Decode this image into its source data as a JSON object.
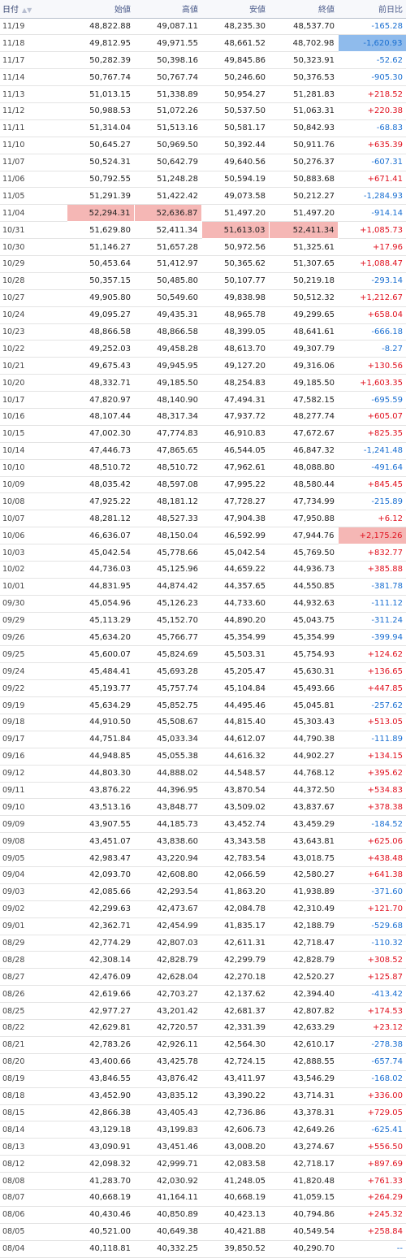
{
  "headers": [
    "日付",
    "始値",
    "高値",
    "安値",
    "終値",
    "前日比"
  ],
  "sort_icon": "▲▼",
  "colors": {
    "up": "#e0101e",
    "down": "#1a6fd1",
    "high_highlight": "#f5b7b5",
    "low_highlight": "#8fbbec"
  },
  "rows": [
    [
      "11/19",
      "48,822.88",
      "49,087.11",
      "48,235.30",
      "48,537.70",
      "-165.28"
    ],
    [
      "11/18",
      "49,812.95",
      "49,971.55",
      "48,661.52",
      "48,702.98",
      "-1,620.93"
    ],
    [
      "11/17",
      "50,282.39",
      "50,398.16",
      "49,845.86",
      "50,323.91",
      "-52.62"
    ],
    [
      "11/14",
      "50,767.74",
      "50,767.74",
      "50,246.60",
      "50,376.53",
      "-905.30"
    ],
    [
      "11/13",
      "51,013.15",
      "51,338.89",
      "50,954.27",
      "51,281.83",
      "+218.52"
    ],
    [
      "11/12",
      "50,988.53",
      "51,072.26",
      "50,537.50",
      "51,063.31",
      "+220.38"
    ],
    [
      "11/11",
      "51,314.04",
      "51,513.16",
      "50,581.17",
      "50,842.93",
      "-68.83"
    ],
    [
      "11/10",
      "50,645.27",
      "50,969.50",
      "50,392.44",
      "50,911.76",
      "+635.39"
    ],
    [
      "11/07",
      "50,524.31",
      "50,642.79",
      "49,640.56",
      "50,276.37",
      "-607.31"
    ],
    [
      "11/06",
      "50,792.55",
      "51,248.28",
      "50,594.19",
      "50,883.68",
      "+671.41"
    ],
    [
      "11/05",
      "51,291.39",
      "51,422.42",
      "49,073.58",
      "50,212.27",
      "-1,284.93"
    ],
    [
      "11/04",
      "52,294.31",
      "52,636.87",
      "51,497.20",
      "51,497.20",
      "-914.14"
    ],
    [
      "10/31",
      "51,629.80",
      "52,411.34",
      "51,613.03",
      "52,411.34",
      "+1,085.73"
    ],
    [
      "10/30",
      "51,146.27",
      "51,657.28",
      "50,972.56",
      "51,325.61",
      "+17.96"
    ],
    [
      "10/29",
      "50,453.64",
      "51,412.97",
      "50,365.62",
      "51,307.65",
      "+1,088.47"
    ],
    [
      "10/28",
      "50,357.15",
      "50,485.80",
      "50,107.77",
      "50,219.18",
      "-293.14"
    ],
    [
      "10/27",
      "49,905.80",
      "50,549.60",
      "49,838.98",
      "50,512.32",
      "+1,212.67"
    ],
    [
      "10/24",
      "49,095.27",
      "49,435.31",
      "48,965.78",
      "49,299.65",
      "+658.04"
    ],
    [
      "10/23",
      "48,866.58",
      "48,866.58",
      "48,399.05",
      "48,641.61",
      "-666.18"
    ],
    [
      "10/22",
      "49,252.03",
      "49,458.28",
      "48,613.70",
      "49,307.79",
      "-8.27"
    ],
    [
      "10/21",
      "49,675.43",
      "49,945.95",
      "49,127.20",
      "49,316.06",
      "+130.56"
    ],
    [
      "10/20",
      "48,332.71",
      "49,185.50",
      "48,254.83",
      "49,185.50",
      "+1,603.35"
    ],
    [
      "10/17",
      "47,820.97",
      "48,140.90",
      "47,494.31",
      "47,582.15",
      "-695.59"
    ],
    [
      "10/16",
      "48,107.44",
      "48,317.34",
      "47,937.72",
      "48,277.74",
      "+605.07"
    ],
    [
      "10/15",
      "47,002.30",
      "47,774.83",
      "46,910.83",
      "47,672.67",
      "+825.35"
    ],
    [
      "10/14",
      "47,446.73",
      "47,865.65",
      "46,544.05",
      "46,847.32",
      "-1,241.48"
    ],
    [
      "10/10",
      "48,510.72",
      "48,510.72",
      "47,962.61",
      "48,088.80",
      "-491.64"
    ],
    [
      "10/09",
      "48,035.42",
      "48,597.08",
      "47,995.22",
      "48,580.44",
      "+845.45"
    ],
    [
      "10/08",
      "47,925.22",
      "48,181.12",
      "47,728.27",
      "47,734.99",
      "-215.89"
    ],
    [
      "10/07",
      "48,281.12",
      "48,527.33",
      "47,904.38",
      "47,950.88",
      "+6.12"
    ],
    [
      "10/06",
      "46,636.07",
      "48,150.04",
      "46,592.99",
      "47,944.76",
      "+2,175.26"
    ],
    [
      "10/03",
      "45,042.54",
      "45,778.66",
      "45,042.54",
      "45,769.50",
      "+832.77"
    ],
    [
      "10/02",
      "44,736.03",
      "45,125.96",
      "44,659.22",
      "44,936.73",
      "+385.88"
    ],
    [
      "10/01",
      "44,831.95",
      "44,874.42",
      "44,357.65",
      "44,550.85",
      "-381.78"
    ],
    [
      "09/30",
      "45,054.96",
      "45,126.23",
      "44,733.60",
      "44,932.63",
      "-111.12"
    ],
    [
      "09/29",
      "45,113.29",
      "45,152.70",
      "44,890.20",
      "45,043.75",
      "-311.24"
    ],
    [
      "09/26",
      "45,634.20",
      "45,766.77",
      "45,354.99",
      "45,354.99",
      "-399.94"
    ],
    [
      "09/25",
      "45,600.07",
      "45,824.69",
      "45,503.31",
      "45,754.93",
      "+124.62"
    ],
    [
      "09/24",
      "45,484.41",
      "45,693.28",
      "45,205.47",
      "45,630.31",
      "+136.65"
    ],
    [
      "09/22",
      "45,193.77",
      "45,757.74",
      "45,104.84",
      "45,493.66",
      "+447.85"
    ],
    [
      "09/19",
      "45,634.29",
      "45,852.75",
      "44,495.46",
      "45,045.81",
      "-257.62"
    ],
    [
      "09/18",
      "44,910.50",
      "45,508.67",
      "44,815.40",
      "45,303.43",
      "+513.05"
    ],
    [
      "09/17",
      "44,751.84",
      "45,033.34",
      "44,612.07",
      "44,790.38",
      "-111.89"
    ],
    [
      "09/16",
      "44,948.85",
      "45,055.38",
      "44,616.32",
      "44,902.27",
      "+134.15"
    ],
    [
      "09/12",
      "44,803.30",
      "44,888.02",
      "44,548.57",
      "44,768.12",
      "+395.62"
    ],
    [
      "09/11",
      "43,876.22",
      "44,396.95",
      "43,870.54",
      "44,372.50",
      "+534.83"
    ],
    [
      "09/10",
      "43,513.16",
      "43,848.77",
      "43,509.02",
      "43,837.67",
      "+378.38"
    ],
    [
      "09/09",
      "43,907.55",
      "44,185.73",
      "43,452.74",
      "43,459.29",
      "-184.52"
    ],
    [
      "09/08",
      "43,451.07",
      "43,838.60",
      "43,343.58",
      "43,643.81",
      "+625.06"
    ],
    [
      "09/05",
      "42,983.47",
      "43,220.94",
      "42,783.54",
      "43,018.75",
      "+438.48"
    ],
    [
      "09/04",
      "42,093.70",
      "42,608.80",
      "42,066.59",
      "42,580.27",
      "+641.38"
    ],
    [
      "09/03",
      "42,085.66",
      "42,293.54",
      "41,863.20",
      "41,938.89",
      "-371.60"
    ],
    [
      "09/02",
      "42,299.63",
      "42,473.67",
      "42,084.78",
      "42,310.49",
      "+121.70"
    ],
    [
      "09/01",
      "42,362.71",
      "42,454.99",
      "41,835.17",
      "42,188.79",
      "-529.68"
    ],
    [
      "08/29",
      "42,774.29",
      "42,807.03",
      "42,611.31",
      "42,718.47",
      "-110.32"
    ],
    [
      "08/28",
      "42,308.14",
      "42,828.79",
      "42,299.79",
      "42,828.79",
      "+308.52"
    ],
    [
      "08/27",
      "42,476.09",
      "42,628.04",
      "42,270.18",
      "42,520.27",
      "+125.87"
    ],
    [
      "08/26",
      "42,619.66",
      "42,703.27",
      "42,137.62",
      "42,394.40",
      "-413.42"
    ],
    [
      "08/25",
      "42,977.27",
      "43,201.42",
      "42,681.37",
      "42,807.82",
      "+174.53"
    ],
    [
      "08/22",
      "42,629.81",
      "42,720.57",
      "42,331.39",
      "42,633.29",
      "+23.12"
    ],
    [
      "08/21",
      "42,783.26",
      "42,926.11",
      "42,564.30",
      "42,610.17",
      "-278.38"
    ],
    [
      "08/20",
      "43,400.66",
      "43,425.78",
      "42,724.15",
      "42,888.55",
      "-657.74"
    ],
    [
      "08/19",
      "43,846.55",
      "43,876.42",
      "43,411.97",
      "43,546.29",
      "-168.02"
    ],
    [
      "08/18",
      "43,452.90",
      "43,835.12",
      "43,390.22",
      "43,714.31",
      "+336.00"
    ],
    [
      "08/15",
      "42,866.38",
      "43,405.43",
      "42,736.86",
      "43,378.31",
      "+729.05"
    ],
    [
      "08/14",
      "43,129.18",
      "43,199.83",
      "42,606.73",
      "42,649.26",
      "-625.41"
    ],
    [
      "08/13",
      "43,090.91",
      "43,451.46",
      "43,008.20",
      "43,274.67",
      "+556.50"
    ],
    [
      "08/12",
      "42,098.32",
      "42,999.71",
      "42,083.58",
      "42,718.17",
      "+897.69"
    ],
    [
      "08/08",
      "41,283.70",
      "42,030.92",
      "41,248.05",
      "41,820.48",
      "+761.33"
    ],
    [
      "08/07",
      "40,668.19",
      "41,164.11",
      "40,668.19",
      "41,059.15",
      "+264.29"
    ],
    [
      "08/06",
      "40,430.46",
      "40,850.89",
      "40,423.13",
      "40,794.86",
      "+245.32"
    ],
    [
      "08/05",
      "40,521.00",
      "40,649.38",
      "40,421.88",
      "40,549.54",
      "+258.84"
    ],
    [
      "08/04",
      "40,118.81",
      "40,332.25",
      "39,850.52",
      "40,290.70",
      "--"
    ]
  ],
  "highlights": {
    "1": {
      "5": "lo"
    },
    "11": {
      "1": "hi",
      "2": "hi"
    },
    "12": {
      "3": "hi",
      "4": "hi"
    },
    "30": {
      "5": "hi"
    },
    "73": {
      "1": "lo",
      "2": "lo",
      "3": "lo",
      "4": "lo"
    }
  }
}
